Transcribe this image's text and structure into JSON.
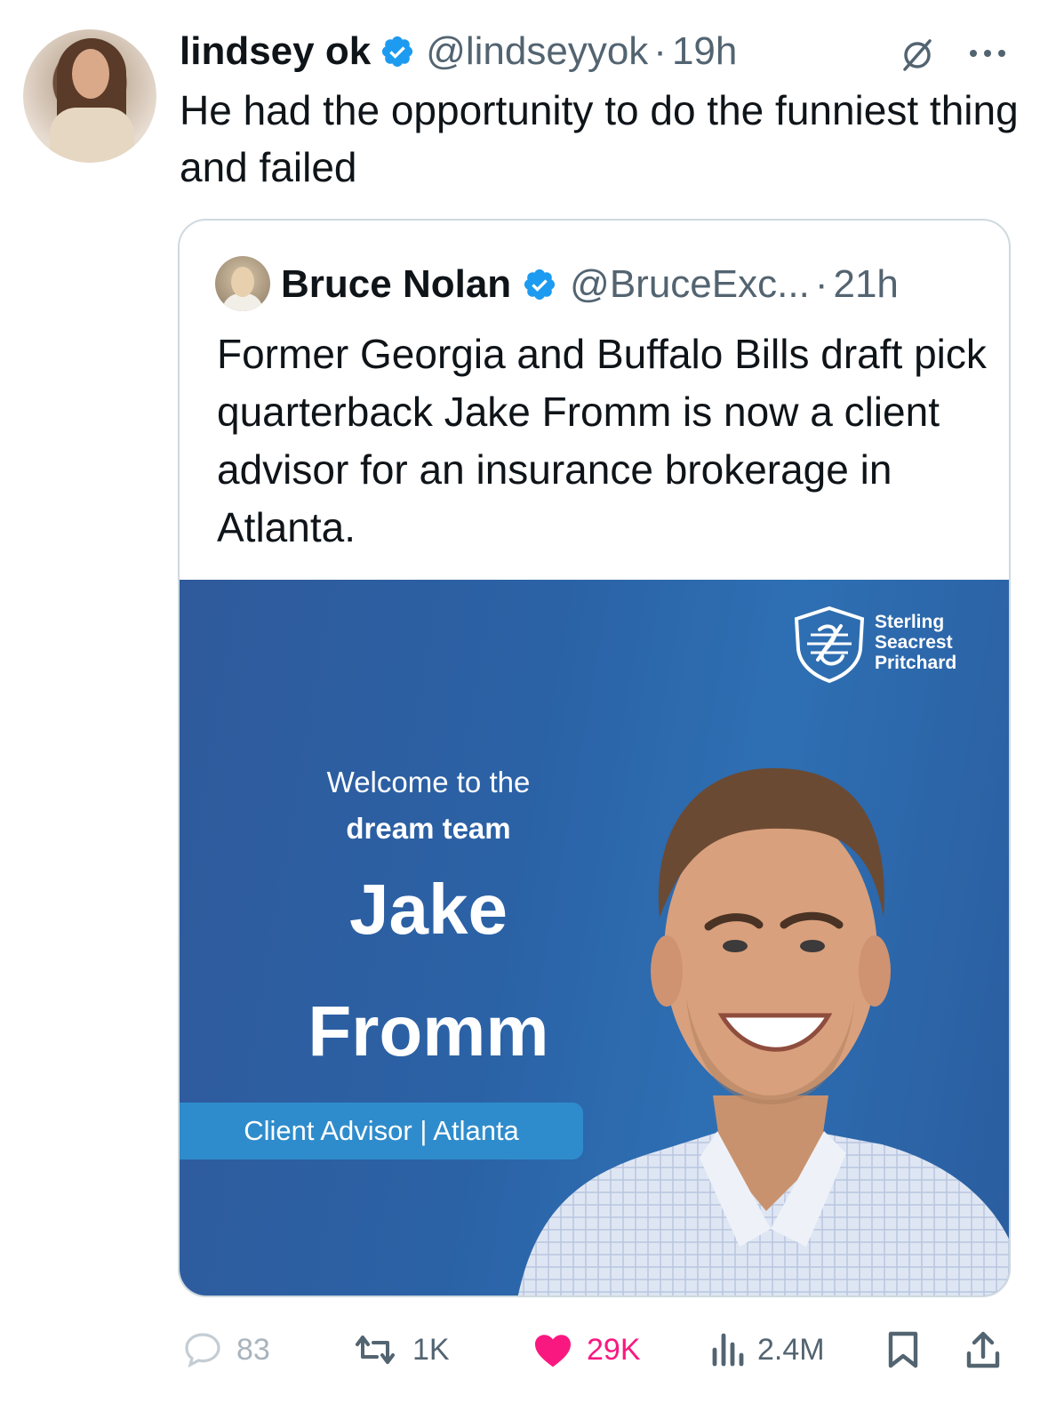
{
  "tweet": {
    "author_name": "lindsey ok",
    "handle": "@lindseyyok",
    "separator": "·",
    "time": "19h",
    "text": "He had the opportunity to do the funniest thing and failed"
  },
  "quoted": {
    "author_name": "Bruce Nolan",
    "handle": "@BruceExc...",
    "separator": "·",
    "time": "21h",
    "text": "Former Georgia and Buffalo Bills draft pick quarterback Jake Fromm is now a client advisor for an insurance brokerage in Atlanta.",
    "media": {
      "logo_lines": [
        "Sterling",
        "Seacrest",
        "Pritchard"
      ],
      "welcome_line1": "Welcome to the",
      "welcome_line2": "dream team",
      "first_name": "Jake",
      "last_name": "Fromm",
      "role": "Client Advisor | Atlanta"
    }
  },
  "actions": {
    "replies": "83",
    "reposts": "1K",
    "likes": "29K",
    "views": "2.4M"
  },
  "colors": {
    "verified": "#1d9bf0",
    "like": "#f91880",
    "muted": "#536471",
    "media_blue": "#2b62a6"
  },
  "icons": [
    "verified-icon",
    "grok-icon",
    "more-icon",
    "reply-icon",
    "repost-icon",
    "like-icon",
    "views-icon",
    "bookmark-icon",
    "share-icon"
  ]
}
